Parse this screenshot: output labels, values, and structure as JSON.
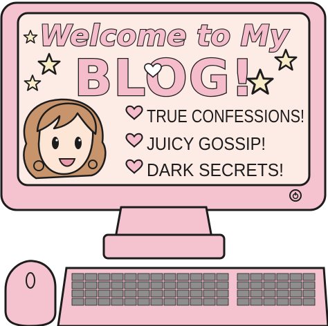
{
  "screen": {
    "welcome_text": "Welcome to My",
    "blog_text": "BLOG!",
    "items": [
      {
        "label": "TRUE CONFESSIONS!"
      },
      {
        "label": "JUICY GOSSIP!"
      },
      {
        "label": "DARK SECRETS!"
      }
    ]
  },
  "colors": {
    "monitor_pink": "#f4c3cf",
    "screen_bg": "#fdebe6",
    "outline": "#1c1c1c",
    "title_pink": "#f5bccb",
    "star_fill": "#f8ecc8",
    "key_gray": "#8e8e8e",
    "hair_brown": "#c8946c",
    "skin": "#fde6d6"
  },
  "icons": {
    "bullet": "heart-icon",
    "power": "power-icon",
    "decoration": "star-icon"
  }
}
